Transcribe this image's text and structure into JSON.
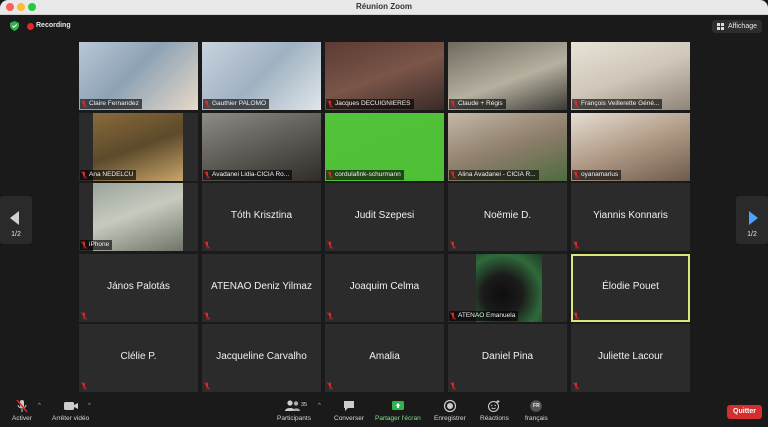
{
  "window": {
    "title": "Réunion Zoom"
  },
  "status": {
    "recording_label": "Recording",
    "view_label": "Affichage"
  },
  "nav": {
    "left_page": "1/2",
    "right_page": "1/2"
  },
  "participants": [
    {
      "name": "Claire Fernandez",
      "video": true
    },
    {
      "name": "Gauthier PALOMO",
      "video": true
    },
    {
      "name": "Jacques DECUIGNIERES",
      "video": true
    },
    {
      "name": "Claude + Régis",
      "video": true
    },
    {
      "name": "François Veillerette Géné...",
      "video": true
    },
    {
      "name": "Ana NEDELCU",
      "video": true
    },
    {
      "name": "Avadanei Lidia-CICIA Ro...",
      "video": true
    },
    {
      "name": "cordulafink-schurmann",
      "video": true
    },
    {
      "name": "Alina Avadanei - CICIA R...",
      "video": true
    },
    {
      "name": "oyanamarius",
      "video": true
    },
    {
      "name": "iPhone",
      "video": true
    },
    {
      "name": "Tóth Krisztina",
      "video": false
    },
    {
      "name": "Judit Szepesi",
      "video": false
    },
    {
      "name": "Noëmie D.",
      "video": false
    },
    {
      "name": "Yiannis Konnaris",
      "video": false
    },
    {
      "name": "János Palotás",
      "video": false
    },
    {
      "name": "ATENAO Deniz Yilmaz",
      "video": false
    },
    {
      "name": "Joaquim Celma",
      "video": false
    },
    {
      "name": "ATENAO Emanuela",
      "video": true
    },
    {
      "name": "Élodie Pouet",
      "video": false,
      "active": true
    },
    {
      "name": "Clélie P.",
      "video": false
    },
    {
      "name": "Jacqueline Carvalho",
      "video": false
    },
    {
      "name": "Amalia",
      "video": false
    },
    {
      "name": "Daniel Pina",
      "video": false
    },
    {
      "name": "Juliette Lacour",
      "video": false
    }
  ],
  "toolbar": {
    "mute": "Activer",
    "video": "Arrêter vidéo",
    "participants": "Participants",
    "participants_count": "35",
    "chat": "Converser",
    "share": "Partager l'écran",
    "record": "Enregistrer",
    "reactions": "Réactions",
    "language": "français",
    "language_badge": "FR",
    "quit": "Quitter"
  },
  "colors": {
    "accent_green": "#2fb24b",
    "active_border": "#d8e879",
    "quit_red": "#d32f2f",
    "mic_muted": "#e02828",
    "nav_blue": "#4ea1ff"
  }
}
